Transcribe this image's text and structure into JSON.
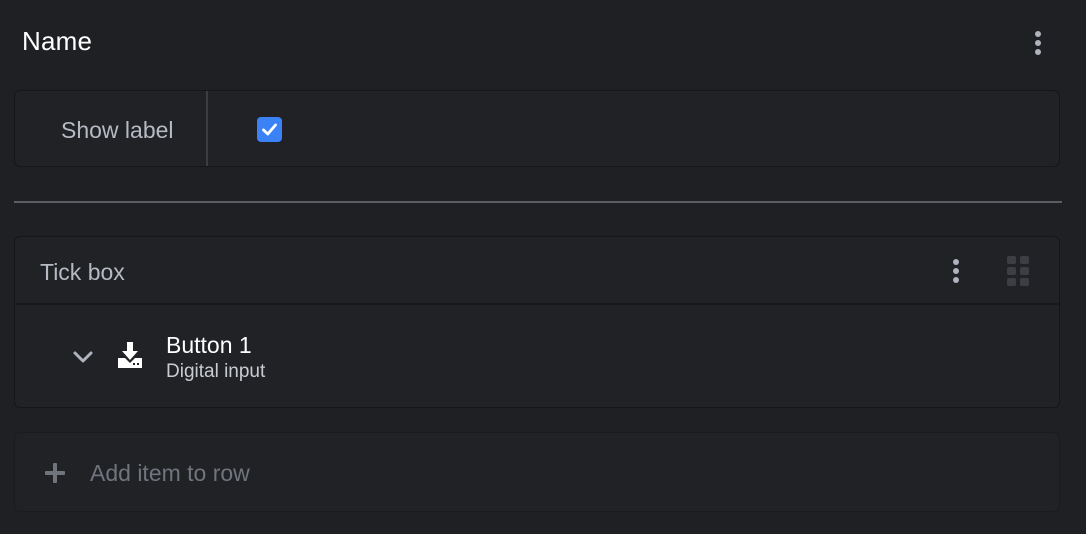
{
  "header": {
    "title": "Name",
    "menu_icon": "kebab-vertical-icon"
  },
  "show_label_row": {
    "label": "Show label",
    "checked": true,
    "accent_color": "#3b82f6"
  },
  "tick_box_group": {
    "title": "Tick box",
    "menu_icon": "kebab-vertical-icon",
    "drag_icon": "drag-handle-icon",
    "items": [
      {
        "name": "Button 1",
        "type": "Digital input",
        "expand_icon": "chevron-down-icon",
        "icon": "download-tray-icon"
      }
    ]
  },
  "add_item": {
    "label": "Add item to row",
    "icon": "plus-icon"
  }
}
